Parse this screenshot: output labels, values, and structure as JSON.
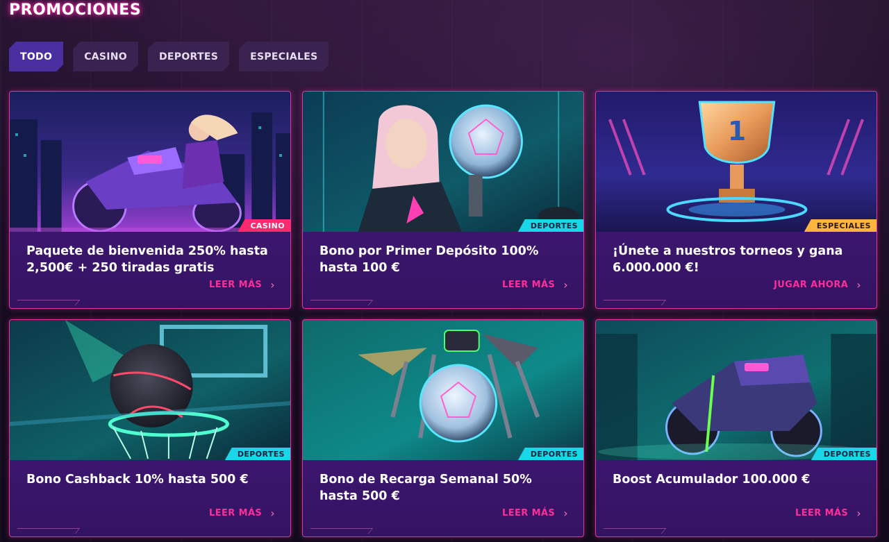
{
  "page_title": "PROMOCIONES",
  "tabs": [
    {
      "label": "TODO",
      "active": true
    },
    {
      "label": "CASINO",
      "active": false
    },
    {
      "label": "DEPORTES",
      "active": false
    },
    {
      "label": "ESPECIALES",
      "active": false
    }
  ],
  "cards": [
    {
      "title": "Paquete de bienvenida 250% hasta 2,500€ + 250 tiradas gratis",
      "badge": "CASINO",
      "cta": "LEER MÁS"
    },
    {
      "title": "Bono por Primer Depósito 100% hasta 100 €",
      "badge": "DEPORTES",
      "cta": "LEER MÁS"
    },
    {
      "title": "¡Únete a nuestros torneos y gana 6.000.000 €!",
      "badge": "ESPECIALES",
      "cta": "JUGAR AHORA"
    },
    {
      "title": "Bono Cashback 10% hasta 500 €",
      "badge": "DEPORTES",
      "cta": "LEER MÁS"
    },
    {
      "title": "Bono de Recarga Semanal 50% hasta 500 €",
      "badge": "DEPORTES",
      "cta": "LEER MÁS"
    },
    {
      "title": "Boost Acumulador 100.000 €",
      "badge": "DEPORTES",
      "cta": "LEER MÁS"
    }
  ],
  "chevron_icon": "chevron-right-icon",
  "colors": {
    "accent_pink": "#ff2d9a",
    "card_purple": "#4a1c80",
    "badge_casino": "#ff2a6e",
    "badge_deportes": "#19d7e8",
    "badge_especiales": "#ffb53b",
    "tab_active": "#4a2fa0"
  }
}
